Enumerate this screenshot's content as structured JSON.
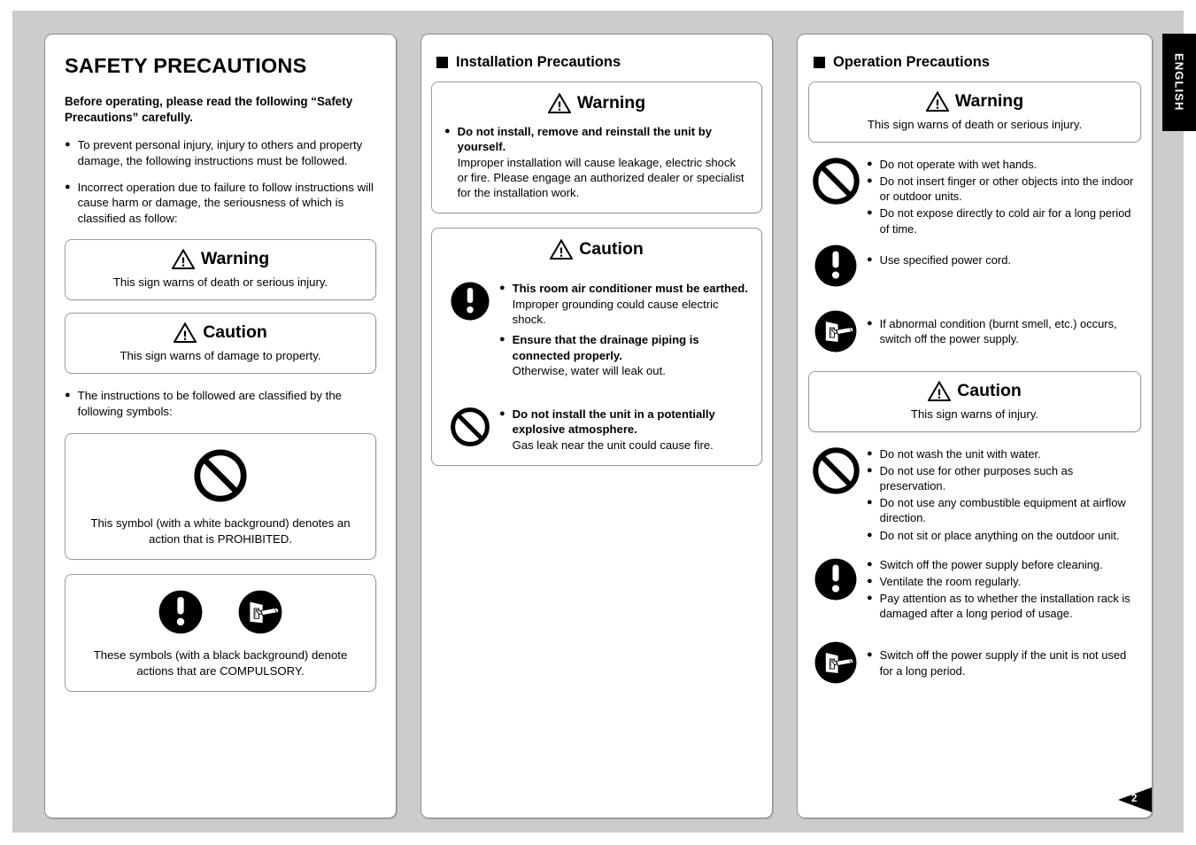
{
  "document": {
    "language_tab": "ENGLISH",
    "page_number": "2"
  },
  "column_left": {
    "title": "SAFETY PRECAUTIONS",
    "intro": "Before operating, please read the following “Safety Precautions” carefully.",
    "bullets": [
      "To prevent personal injury, injury to others and property damage, the following instructions must be followed.",
      "Incorrect operation due to failure to follow instructions will cause harm or damage, the seriousness of which is classified as follow:"
    ],
    "warning_box": {
      "heading": "Warning",
      "subtext": "This sign warns of death or serious injury."
    },
    "caution_box": {
      "heading": "Caution",
      "subtext": "This sign warns of damage to property."
    },
    "symbols_intro": "The instructions to be followed are classified by the following symbols:",
    "prohibited_box": {
      "caption": "This symbol (with a white background) denotes an action that is PROHIBITED."
    },
    "compulsory_box": {
      "caption": "These symbols (with a black background) denote actions that are COMPULSORY."
    }
  },
  "column_middle": {
    "section_title": "Installation Precautions",
    "warning_box": {
      "heading": "Warning",
      "items": [
        {
          "bold": "Do not install, remove and reinstall the unit by yourself.",
          "normal": "Improper installation will cause leakage, electric shock or fire. Please engage an authorized dealer or specialist for the installation work."
        }
      ]
    },
    "caution_box": {
      "heading": "Caution",
      "groups": [
        {
          "icon": "compulsory-icon",
          "items": [
            {
              "bold": "This room air conditioner must be earthed.",
              "normal": "Improper grounding could cause electric shock."
            },
            {
              "bold": "Ensure that the drainage piping is connected properly.",
              "normal": "Otherwise, water will leak out."
            }
          ]
        },
        {
          "icon": "prohibited-icon",
          "items": [
            {
              "bold": "Do not install the unit in a potentially explosive atmosphere.",
              "normal": "Gas leak near the unit could cause fire."
            }
          ]
        }
      ]
    }
  },
  "column_right": {
    "section_title": "Operation Precautions",
    "warning_box": {
      "heading": "Warning",
      "subtext": "This sign warns of death or serious injury."
    },
    "warning_groups": [
      {
        "icon": "prohibited-icon",
        "items": [
          "Do not operate with wet hands.",
          "Do not insert finger or other objects into the indoor or outdoor units.",
          "Do not expose directly to cold air for a long period of time."
        ]
      },
      {
        "icon": "compulsory-icon",
        "items": [
          "Use specified power cord."
        ]
      },
      {
        "icon": "power-off-switch-icon",
        "items": [
          "If abnormal condition (burnt smell, etc.) occurs, switch off the power supply."
        ]
      }
    ],
    "caution_box": {
      "heading": "Caution",
      "subtext": "This sign warns of injury."
    },
    "caution_groups": [
      {
        "icon": "prohibited-icon",
        "items": [
          "Do not wash the unit with water.",
          "Do not use for other purposes such as preservation.",
          "Do not use any combustible equipment at airflow direction.",
          "Do not sit or place anything on the outdoor unit."
        ]
      },
      {
        "icon": "compulsory-icon",
        "items": [
          "Switch off the power supply before cleaning.",
          "Ventilate the room regularly.",
          "Pay attention as to whether the installation rack is damaged after a long period of usage."
        ]
      },
      {
        "icon": "power-off-switch-icon",
        "items": [
          "Switch off the power supply if the unit is not used for a long period."
        ]
      }
    ]
  },
  "colors": {
    "page_background": "#cccccc",
    "panel_background": "#ffffff",
    "panel_border": "#8f8f8f",
    "text": "#000000",
    "tab_background": "#000000",
    "tab_text": "#ffffff"
  }
}
